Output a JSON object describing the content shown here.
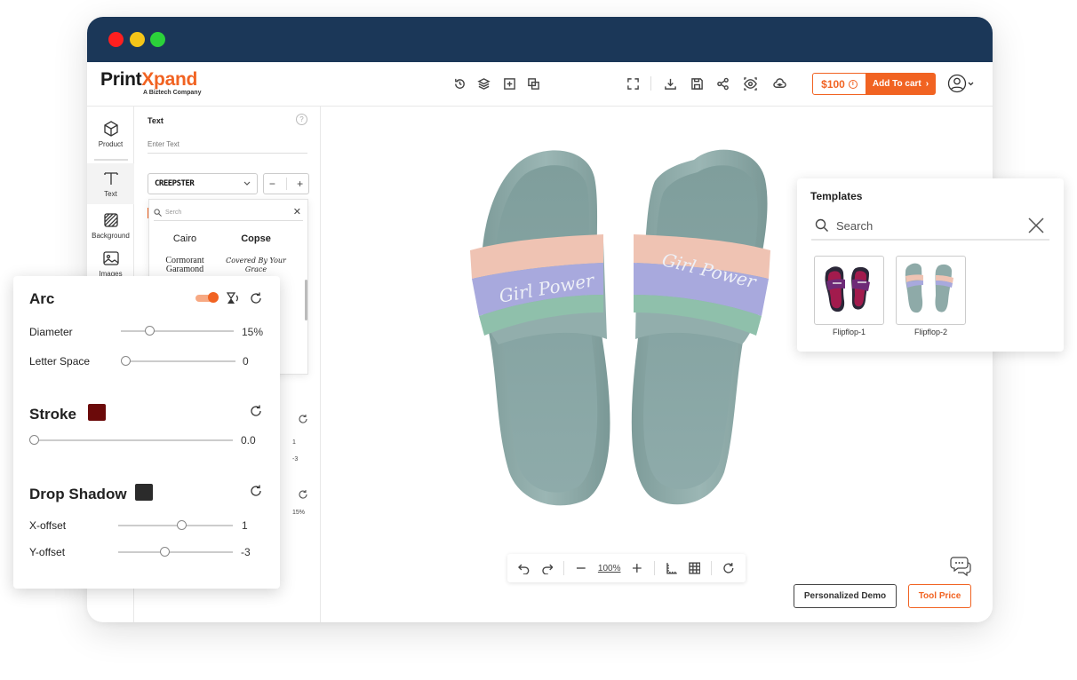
{
  "brand": {
    "logo_left": "Print",
    "logo_accent": "Xpand",
    "tagline": "A Biztech Company"
  },
  "toolbar": {
    "price": "$100",
    "add_to_cart": "Add To cart"
  },
  "sidebar": {
    "items": [
      {
        "label": "Product",
        "icon": "cube-icon"
      },
      {
        "label": "Text",
        "icon": "text-icon"
      },
      {
        "label": "Background",
        "icon": "background-icon"
      },
      {
        "label": "Images",
        "icon": "image-icon"
      }
    ]
  },
  "text_panel": {
    "title": "Text",
    "help": "?",
    "input_placeholder": "Enter Text",
    "font_name": "CREEPSTER",
    "stepper_minus": "−",
    "stepper_plus": "+",
    "font_search_placeholder": "Serch",
    "fonts": [
      "Cairo",
      "Copse",
      "Cormorant Garamond",
      "Covered By Your Grace"
    ],
    "hidden_values": [
      "1",
      "-3",
      "15%"
    ]
  },
  "arc_panel": {
    "arc_title": "Arc",
    "diameter_label": "Diameter",
    "diameter_value": "15%",
    "diameter_level": 0.25,
    "letter_space_label": "Letter Space",
    "letter_space_value": "0",
    "letter_space_level": 0,
    "stroke_title": "Stroke",
    "stroke_color": "#6b0a0a",
    "stroke_value": "0.0",
    "stroke_level": 0,
    "shadow_title": "Drop Shadow",
    "shadow_color": "#2b2b2b",
    "x_offset_label": "X-offset",
    "x_offset_value": "1",
    "x_offset_level": 0.55,
    "y_offset_label": "Y-offset",
    "y_offset_value": "-3",
    "y_offset_level": 0.4
  },
  "canvas": {
    "product_text": "Girl Power",
    "zoom": "100%",
    "demo_button": "Personalized Demo",
    "tool_price_button": "Tool Price"
  },
  "templates": {
    "title": "Templates",
    "search_placeholder": "Search",
    "items": [
      {
        "label": "Flipflop-1"
      },
      {
        "label": "Flipflop-2"
      }
    ]
  },
  "colors": {
    "brand_orange": "#f16322",
    "titlebar_navy": "#1b3758",
    "slipper_teal": "#8eaaa8"
  }
}
